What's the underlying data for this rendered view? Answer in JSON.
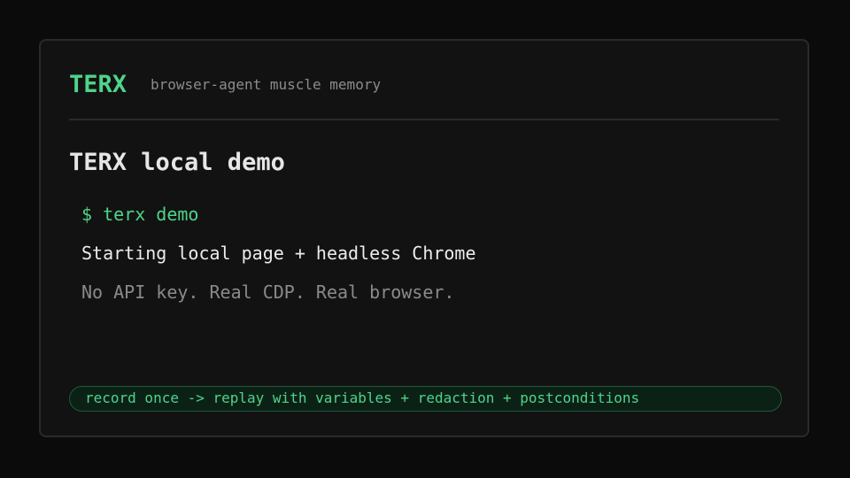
{
  "header": {
    "brand": "TERX",
    "tagline": "browser-agent muscle memory"
  },
  "main": {
    "title": "TERX local demo",
    "terminal": {
      "command": "$ terx demo",
      "output": "Starting local page + headless Chrome",
      "note": "No API key. Real CDP. Real browser."
    }
  },
  "footer": {
    "banner": "record once -> replay with variables + redaction + postconditions"
  },
  "colors": {
    "accent": "#4ed48a",
    "background": "#0b0b0b",
    "card": "#121212",
    "border": "#2a2a2a",
    "muted": "#8a8a8a"
  }
}
